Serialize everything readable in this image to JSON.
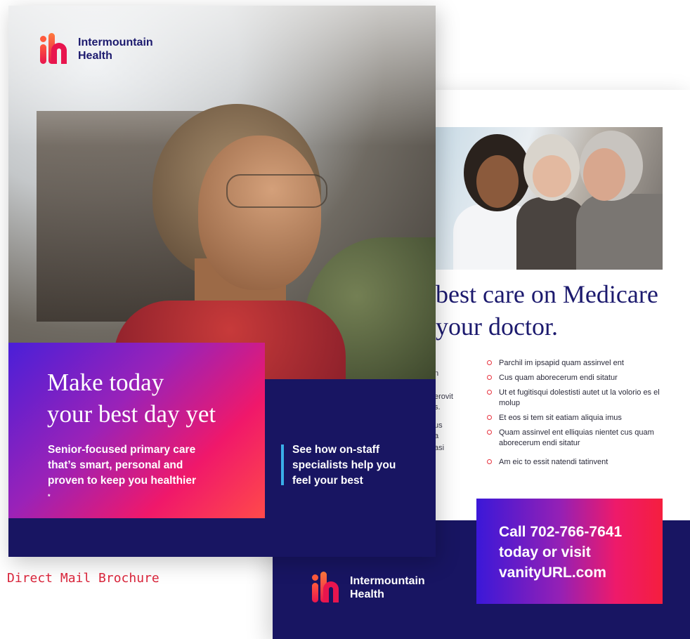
{
  "brand": {
    "name_line1": "Intermountain",
    "name_line2": "Health"
  },
  "front_cover": {
    "headline_lines": [
      "Make today",
      "your best day yet"
    ],
    "subhead_lines": [
      "Senior-focused primary care",
      "that’s smart, personal and",
      "proven to keep you healthier"
    ],
    "subhead_mark": "*",
    "callout_lines": [
      "See how on-staff",
      "specialists help you",
      "feel your best"
    ]
  },
  "inside_spread": {
    "headline_lines": [
      "best care on Medicare",
      "your doctor."
    ],
    "fragments": [
      "n",
      "erovit",
      "s.",
      "us",
      "a",
      "asi"
    ],
    "bullets": [
      "Parchil im ipsapid quam assinvel ent",
      "Cus quam aborecerum endi sitatur",
      "Ut et fugitisqui dolestisti autet ut la volorio es el molup",
      "Et eos si tem sit eatiam aliquia imus",
      "Quam assinvel ent elliquias nientet cus quam aborecerum endi sitatur",
      "Am eic to essit natendi tatinvent"
    ],
    "cta_lines": [
      "Call 702-766-7641",
      "today or visit",
      "vanityURL.com"
    ]
  },
  "caption": "Direct Mail Brochure",
  "colors": {
    "navy": "#181562",
    "brand_red": "#e8154e",
    "caption_red": "#d8243a",
    "accent_blue": "#3aaee8"
  }
}
